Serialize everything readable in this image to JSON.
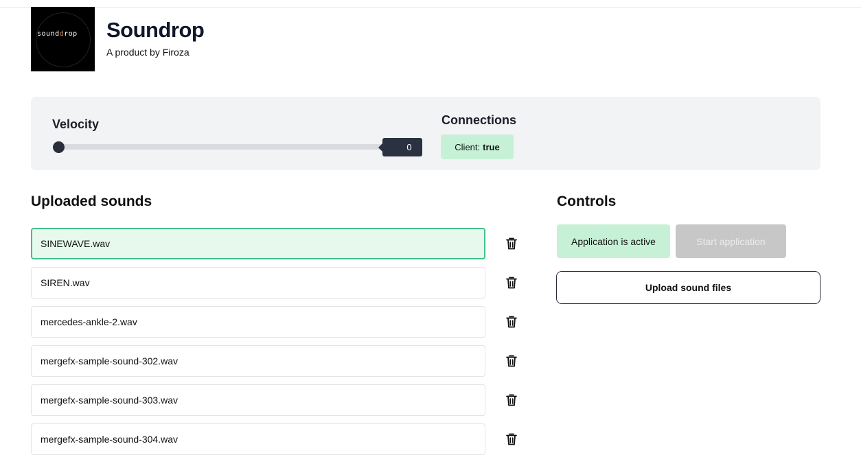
{
  "header": {
    "logo_text_a": "sound",
    "logo_text_b": "rop",
    "logo_accent": "d",
    "title": "Soundrop",
    "subtitle": "A product by Firoza"
  },
  "panel": {
    "velocity_label": "Velocity",
    "velocity_value": "0",
    "velocity_level": 0,
    "connections_label": "Connections",
    "client_label": "Client:",
    "client_value": "true"
  },
  "sounds": {
    "title": "Uploaded sounds",
    "items": [
      {
        "name": "SINEWAVE.wav",
        "selected": true
      },
      {
        "name": "SIREN.wav",
        "selected": false
      },
      {
        "name": "mercedes-ankle-2.wav",
        "selected": false
      },
      {
        "name": "mergefx-sample-sound-302.wav",
        "selected": false
      },
      {
        "name": "mergefx-sample-sound-303.wav",
        "selected": false
      },
      {
        "name": "mergefx-sample-sound-304.wav",
        "selected": false
      }
    ],
    "delete_icon": "trash-icon"
  },
  "controls": {
    "title": "Controls",
    "status": "Application is active",
    "start_label": "Start application",
    "upload_label": "Upload sound files"
  },
  "colors": {
    "success_bg": "#c6f1d6",
    "selected_border": "#41c08a",
    "dark": "#2a3140",
    "disabled": "#c7c7c7"
  }
}
